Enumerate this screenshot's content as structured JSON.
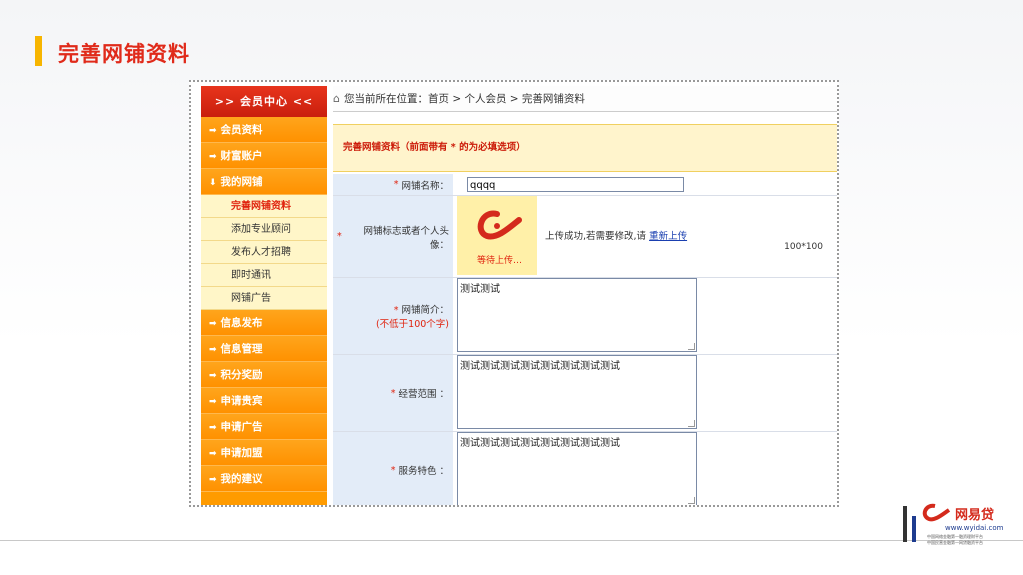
{
  "slide": {
    "title": "完善网铺资料",
    "colors": {
      "accent_bar": "#f7b500",
      "title": "#e02a1a"
    }
  },
  "logo": {
    "brand": "网易贷",
    "url": "www.wyidai.com",
    "tagline1": "中国网络金融第一融资理财平台",
    "tagline2": "中国民营金融第一网贷融资平台"
  },
  "sidebar": {
    "header": ">> 会员中心 <<",
    "items_top": [
      {
        "label": "会员资料",
        "arrow": "➡"
      },
      {
        "label": "财富账户",
        "arrow": "➡"
      },
      {
        "label": "我的网铺",
        "arrow": "⬇"
      }
    ],
    "subitems": [
      {
        "label": "完善网铺资料",
        "active": true
      },
      {
        "label": "添加专业顾问"
      },
      {
        "label": "发布人才招聘"
      },
      {
        "label": "即时通讯"
      },
      {
        "label": "网铺广告"
      }
    ],
    "items_bottom": [
      {
        "label": "信息发布"
      },
      {
        "label": "信息管理"
      },
      {
        "label": "积分奖励"
      },
      {
        "label": "申请贵宾"
      },
      {
        "label": "申请广告"
      },
      {
        "label": "申请加盟"
      },
      {
        "label": "我的建议"
      }
    ]
  },
  "breadcrumb": "您当前所在位置：首页 > 个人会员 > 完善网铺资料",
  "notice": "完善网铺资料（前面带有 * 的为必填选项）",
  "form": {
    "shop_name_label": "网铺名称：",
    "shop_name_value": "qqqq",
    "logo_label": "网铺标志或者个人头像：",
    "upload_waiting": "等待上传…",
    "upload_msg": "上传成功,若需要修改,请 ",
    "reupload_link": "重新上传",
    "logo_size": "100*100",
    "intro_label": "网铺简介：",
    "intro_hint": "(不低于100个字)",
    "intro_value": "测试测试",
    "scope_label": "经营范围 ：",
    "scope_value": "测试测试测试测试测试测试测试测试",
    "feature_label": "服务特色 ：",
    "feature_value": "测试测试测试测试测试测试测试测试",
    "required_mark": "*"
  }
}
